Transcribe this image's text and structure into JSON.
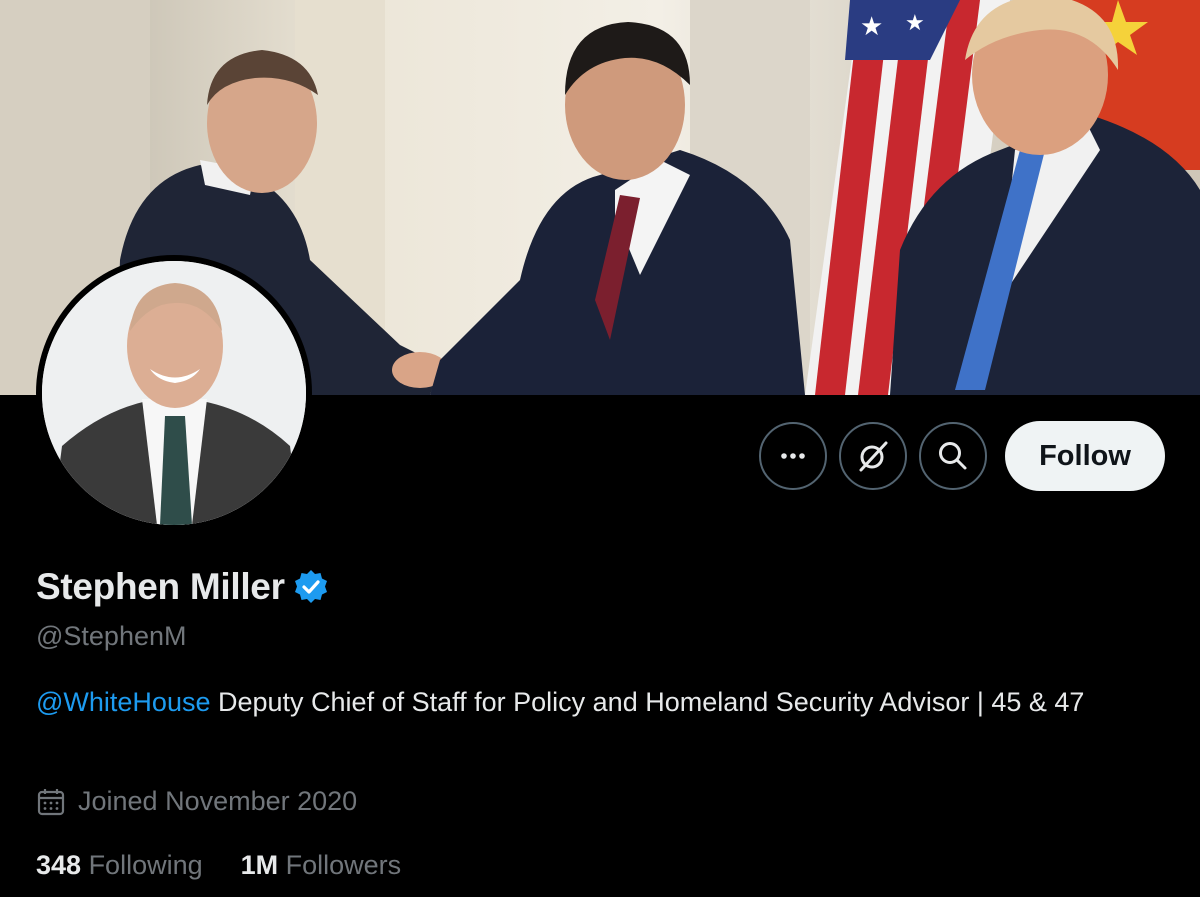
{
  "banner": {
    "description_icon": "banner-photo"
  },
  "actions": {
    "more_icon": "more-icon",
    "grok_icon": "grok-icon",
    "search_icon": "search-icon",
    "follow_label": "Follow"
  },
  "profile": {
    "name": "Stephen Miller",
    "verified_icon": "verified-badge-icon",
    "handle": "@StephenM",
    "bio_mention": "@WhiteHouse",
    "bio_text": " Deputy Chief of Staff for Policy and Homeland Security Advisor | 45 & 47",
    "joined_icon": "calendar-icon",
    "joined": "Joined November 2020",
    "following_count": "348",
    "following_label": " Following",
    "followers_count": "1M",
    "followers_label": " Followers"
  },
  "colors": {
    "accent": "#1d9bf0",
    "muted": "#71767b",
    "text": "#e7e9ea",
    "background": "#000000"
  }
}
